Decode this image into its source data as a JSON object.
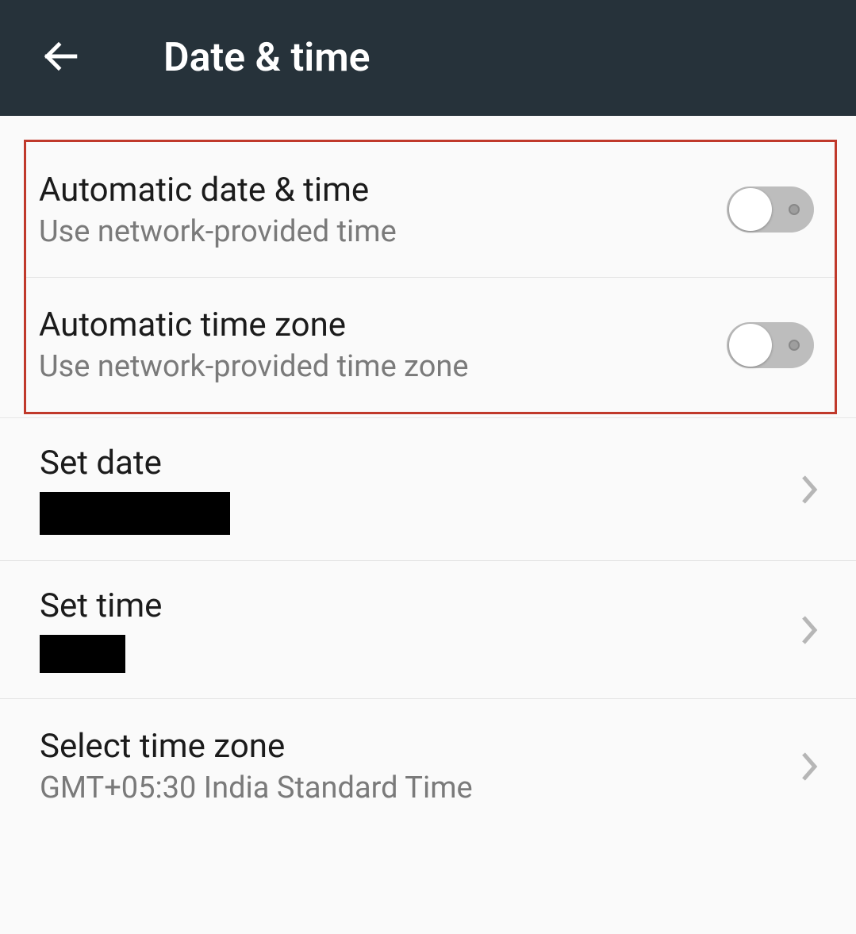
{
  "header": {
    "title": "Date & time"
  },
  "settings": {
    "auto_date_time": {
      "title": "Automatic date & time",
      "subtitle": "Use network-provided time",
      "enabled": false
    },
    "auto_time_zone": {
      "title": "Automatic time zone",
      "subtitle": "Use network-provided time zone",
      "enabled": false
    },
    "set_date": {
      "title": "Set date"
    },
    "set_time": {
      "title": "Set time"
    },
    "select_time_zone": {
      "title": "Select time zone",
      "subtitle": "GMT+05:30 India Standard Time"
    }
  }
}
